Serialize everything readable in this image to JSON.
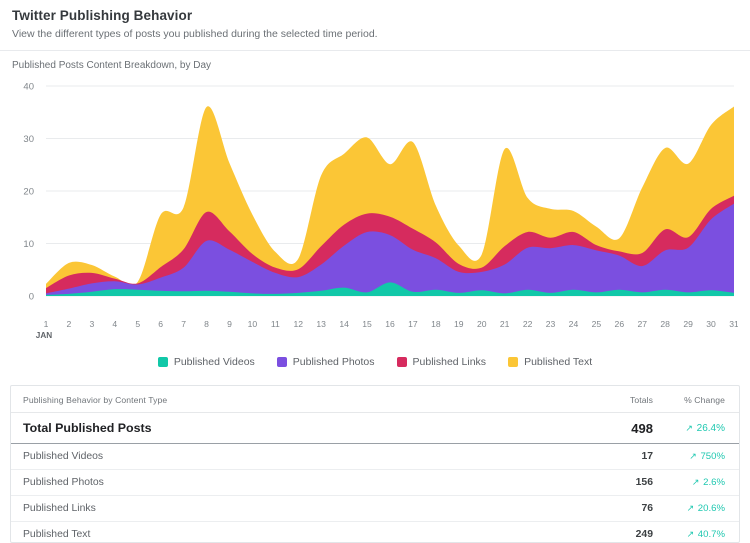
{
  "header": {
    "title": "Twitter Publishing Behavior",
    "subtitle": "View the different types of posts you published during the selected time period."
  },
  "chart_card": {
    "caption": "Published Posts Content Breakdown, by Day"
  },
  "legend": {
    "items": [
      {
        "label": "Published Videos",
        "color": "#11c8a8",
        "icon": "square-swatch-icon"
      },
      {
        "label": "Published Photos",
        "color": "#7b4fe0",
        "icon": "square-swatch-icon"
      },
      {
        "label": "Published Links",
        "color": "#d62b5e",
        "icon": "square-swatch-icon"
      },
      {
        "label": "Published Text",
        "color": "#fbc636",
        "icon": "square-swatch-icon"
      }
    ]
  },
  "table": {
    "headers": {
      "name": "Publishing Behavior by Content Type",
      "totals": "Totals",
      "change": "% Change"
    },
    "total_row": {
      "label": "Total Published Posts",
      "total": "498",
      "change": "26.4%",
      "arrow": "↗",
      "arrow_icon": "arrow-up-right-icon"
    },
    "rows": [
      {
        "label": "Published Videos",
        "total": "17",
        "change": "750%",
        "arrow": "↗",
        "arrow_icon": "arrow-up-right-icon"
      },
      {
        "label": "Published Photos",
        "total": "156",
        "change": "2.6%",
        "arrow": "↗",
        "arrow_icon": "arrow-up-right-icon"
      },
      {
        "label": "Published Links",
        "total": "76",
        "change": "20.6%",
        "arrow": "↗",
        "arrow_icon": "arrow-up-right-icon"
      },
      {
        "label": "Published Text",
        "total": "249",
        "change": "40.7%",
        "arrow": "↗",
        "arrow_icon": "arrow-up-right-icon"
      }
    ]
  },
  "chart_data": {
    "type": "area",
    "stacked": true,
    "title": "Published Posts Content Breakdown, by Day",
    "xlabel": "JAN",
    "ylabel": "",
    "month_label": "JAN",
    "grid": true,
    "legend_position": "bottom",
    "ylim": [
      0,
      40
    ],
    "yticks": [
      0,
      10,
      20,
      30,
      40
    ],
    "x": [
      1,
      2,
      3,
      4,
      5,
      6,
      7,
      8,
      9,
      10,
      11,
      12,
      13,
      14,
      15,
      16,
      17,
      18,
      19,
      20,
      21,
      22,
      23,
      24,
      25,
      26,
      27,
      28,
      29,
      30,
      31
    ],
    "xticklabels": [
      "1",
      "2",
      "3",
      "4",
      "5",
      "6",
      "7",
      "8",
      "9",
      "10",
      "11",
      "12",
      "13",
      "14",
      "15",
      "16",
      "17",
      "18",
      "19",
      "20",
      "21",
      "22",
      "23",
      "24",
      "25",
      "26",
      "27",
      "28",
      "29",
      "30",
      "31"
    ],
    "series": [
      {
        "name": "Published Videos",
        "color": "#11c8a8",
        "values": [
          0.2,
          0.4,
          0.8,
          1.3,
          1.2,
          1.0,
          0.9,
          1.0,
          0.8,
          0.5,
          0.4,
          0.6,
          1.0,
          1.6,
          0.7,
          2.6,
          0.8,
          1.2,
          0.6,
          1.1,
          0.5,
          1.2,
          0.6,
          1.2,
          0.7,
          1.2,
          0.7,
          1.2,
          0.7,
          1.1,
          0.6
        ]
      },
      {
        "name": "Published Photos",
        "color": "#7b4fe0",
        "values": [
          0.3,
          1.0,
          1.6,
          1.5,
          1.0,
          2.5,
          4.5,
          9.5,
          8.0,
          6.0,
          4.0,
          3.0,
          5.0,
          8.0,
          11.5,
          9.0,
          8.0,
          6.0,
          4.0,
          3.5,
          5.5,
          8.0,
          8.5,
          8.5,
          8.0,
          6.5,
          5.0,
          7.5,
          8.5,
          13.5,
          17.0
        ]
      },
      {
        "name": "Published Links",
        "color": "#d62b5e",
        "values": [
          1.0,
          2.5,
          2.0,
          0.5,
          0.2,
          2.0,
          3.5,
          5.5,
          3.5,
          1.5,
          1.0,
          1.5,
          3.5,
          4.0,
          3.5,
          3.5,
          4.0,
          3.0,
          1.5,
          0.8,
          3.5,
          3.0,
          2.0,
          2.5,
          1.0,
          0.8,
          2.5,
          4.0,
          2.0,
          2.0,
          1.5
        ]
      },
      {
        "name": "Published Text",
        "color": "#fbc636",
        "values": [
          0.8,
          2.4,
          1.5,
          0.4,
          0.3,
          10.0,
          8.0,
          20.0,
          13.0,
          7.5,
          3.0,
          2.0,
          13.5,
          13.5,
          14.5,
          10.0,
          16.5,
          7.0,
          3.5,
          2.5,
          18.5,
          6.5,
          5.5,
          4.0,
          3.5,
          2.5,
          12.5,
          15.5,
          14.0,
          16.0,
          17.0
        ]
      }
    ],
    "totals_by_day": [
      2.3,
      6.3,
      5.9,
      3.7,
      2.7,
      15.5,
      16.9,
      36.0,
      25.3,
      15.5,
      8.4,
      7.1,
      23.0,
      27.1,
      30.2,
      25.1,
      29.3,
      17.2,
      9.6,
      7.9,
      28.0,
      18.7,
      16.6,
      16.2,
      13.2,
      11.0,
      20.7,
      28.2,
      25.2,
      32.6,
      36.1
    ]
  }
}
